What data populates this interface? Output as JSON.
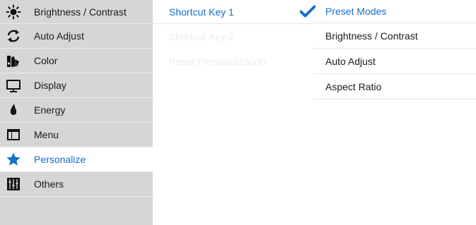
{
  "accent_color": "#1570c9",
  "sidebar": {
    "items": [
      {
        "label": "Brightness / Contrast",
        "icon": "brightness-icon"
      },
      {
        "label": "Auto Adjust",
        "icon": "auto-adjust-icon"
      },
      {
        "label": "Color",
        "icon": "color-icon"
      },
      {
        "label": "Display",
        "icon": "display-icon"
      },
      {
        "label": "Energy",
        "icon": "energy-icon"
      },
      {
        "label": "Menu",
        "icon": "menu-icon"
      },
      {
        "label": "Personalize",
        "icon": "star-icon",
        "active": true
      },
      {
        "label": "Others",
        "icon": "others-icon"
      }
    ]
  },
  "submenu": {
    "items": [
      {
        "label": "Shortcut Key 1",
        "state": "active"
      },
      {
        "label": "Shortcut Key 2",
        "state": "disabled"
      },
      {
        "label": "Reset Personalization",
        "state": "disabled"
      }
    ]
  },
  "options": {
    "items": [
      {
        "label": "Preset Modes",
        "selected": true
      },
      {
        "label": "Brightness / Contrast",
        "selected": false
      },
      {
        "label": "Auto Adjust",
        "selected": false
      },
      {
        "label": "Aspect Ratio",
        "selected": false
      }
    ]
  }
}
